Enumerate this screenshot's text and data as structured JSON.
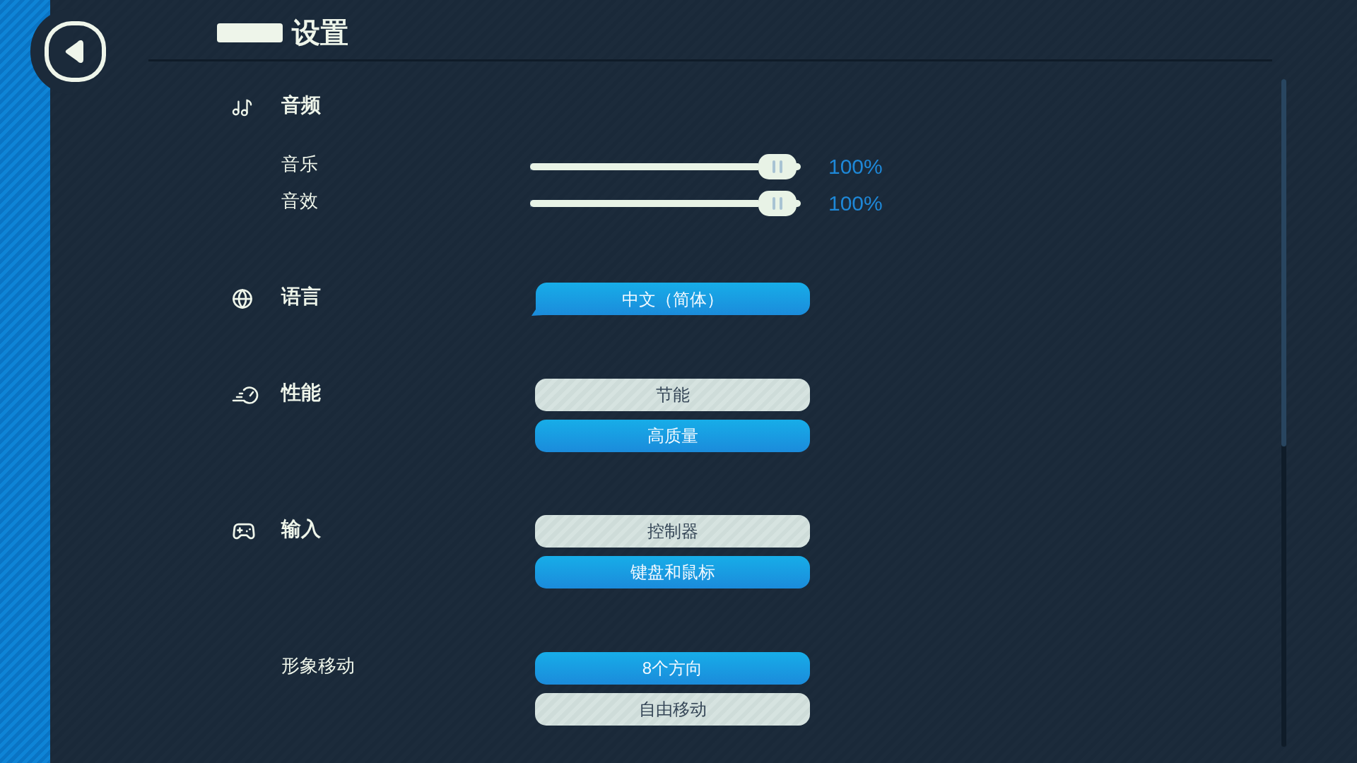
{
  "header": {
    "title": "设置"
  },
  "sections": [
    {
      "heading": "音频",
      "settings": [
        {
          "kind": "slider",
          "label": "音乐",
          "level": 1,
          "reading": "100%"
        },
        {
          "kind": "slider",
          "label": "音效",
          "level": 1,
          "reading": "100%"
        }
      ]
    },
    {
      "heading": "语言",
      "settings": [
        {
          "kind": "dropdown",
          "value": "中文（简体）"
        }
      ]
    },
    {
      "heading": "性能",
      "settings": [
        {
          "kind": "options",
          "options": [
            {
              "label": "节能",
              "selected": false
            },
            {
              "label": "高质量",
              "selected": true
            }
          ]
        }
      ]
    },
    {
      "heading": "输入",
      "settings": [
        {
          "kind": "options",
          "options": [
            {
              "label": "控制器",
              "selected": false
            },
            {
              "label": "键盘和鼠标",
              "selected": true
            }
          ]
        },
        {
          "kind": "options",
          "label": "形象移动",
          "options": [
            {
              "label": "8个方向",
              "selected": true
            },
            {
              "label": "自由移动",
              "selected": false
            }
          ]
        }
      ]
    }
  ]
}
